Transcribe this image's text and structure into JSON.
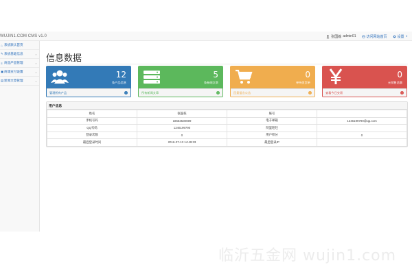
{
  "header": {
    "brand": "WUJIN1.COM CMS v1.0",
    "user_label": "张国栋",
    "user_name": "admin01",
    "visit_link": "访问网站首页",
    "settings_label": "设置"
  },
  "sidebar": {
    "items": [
      {
        "label": "系统默认首页",
        "icon": "home-icon",
        "has_chevron": false
      },
      {
        "label": "系统基础信息",
        "icon": "wrench-icon",
        "has_chevron": true
      },
      {
        "label": "商品产品管理",
        "icon": "list-icon",
        "has_chevron": true
      },
      {
        "label": "商城支付设置",
        "icon": "cart-icon",
        "has_chevron": true
      },
      {
        "label": "新闻文章管理",
        "icon": "file-icon",
        "has_chevron": true
      }
    ]
  },
  "page": {
    "title": "信息数据"
  },
  "panels": [
    {
      "value": "12",
      "caption": "条产品信息",
      "footer": "管理所有产品",
      "color": "#337ab7",
      "icon": "users-icon"
    },
    {
      "value": "5",
      "caption": "条新闻文章",
      "footer": "所有新闻文章",
      "color": "#5cb85c",
      "icon": "list-icon"
    },
    {
      "value": "0",
      "caption": "单待发货单",
      "footer": "回复留言公告",
      "color": "#f0ad4e",
      "icon": "cart-icon"
    },
    {
      "value": "0",
      "caption": "元销售总额",
      "footer": "查看今日交易",
      "color": "#d9534f",
      "icon": "yen-icon"
    }
  ],
  "user_info": {
    "heading": "用户信息",
    "rows": [
      [
        "姓名",
        "张国栋",
        "账号",
        ""
      ],
      [
        "手机号码",
        "18653530699",
        "电子邮箱",
        "1246199790@qq.com"
      ],
      [
        "QQ号码",
        "1246199790",
        "阿里旺旺",
        ""
      ],
      [
        "登录次数",
        "0",
        "用户积分",
        "0"
      ],
      [
        "最后登录时间",
        "2016-07-13 14:49:33",
        "最后登录IP",
        ""
      ]
    ]
  },
  "watermark": "临沂五金网 wujin1.com"
}
